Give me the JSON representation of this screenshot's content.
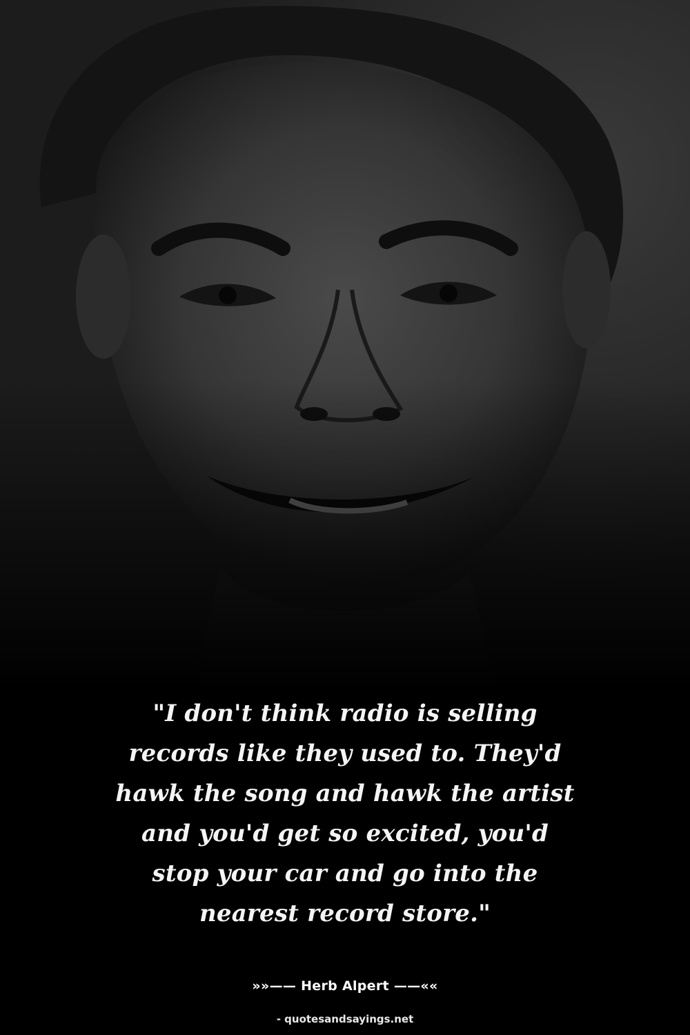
{
  "photo": {
    "subject_icon": "portrait-photo",
    "tone": "#2a2a2a"
  },
  "quote": {
    "lines": [
      "\"I don't think radio is selling",
      "records like they used to. They'd",
      "hawk the song and hawk the artist",
      "and you'd get so excited, you'd",
      "stop your car and go into the",
      "nearest record store.\""
    ]
  },
  "author": "»»—— Herb Alpert ——««",
  "source": "- quotesandsayings.net",
  "colors": {
    "background": "#000000",
    "text": "#f4f4f4"
  }
}
